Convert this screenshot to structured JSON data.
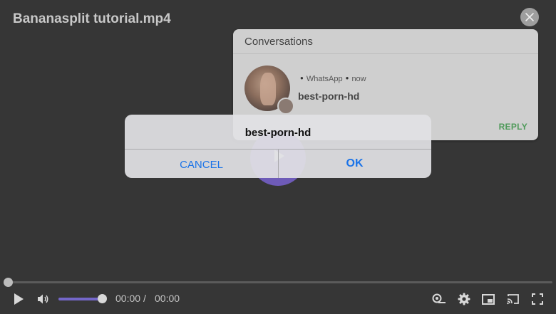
{
  "player": {
    "title": "Bananasplit tutorial.mp4",
    "accent_color": "#7467c9",
    "time": {
      "current": "00:00",
      "separator": "/",
      "duration": "00:00"
    },
    "progress": 0,
    "volume": 1,
    "icons": {
      "close": "close-icon",
      "play": "play-icon",
      "volume": "volume-icon",
      "captions": "captions-icon",
      "settings": "gear-icon",
      "pip": "picture-in-picture-icon",
      "cast": "cast-icon",
      "fullscreen": "fullscreen-icon"
    }
  },
  "notification": {
    "header": "Conversations",
    "app": "WhatsApp",
    "time": "now",
    "sender": "best-porn-hd",
    "reply_label": "REPLY",
    "reply_color": "#4f9a5a"
  },
  "dialog": {
    "title": "best-porn-hd",
    "cancel_label": "CANCEL",
    "ok_label": "OK",
    "button_color": "#1a73e8"
  }
}
